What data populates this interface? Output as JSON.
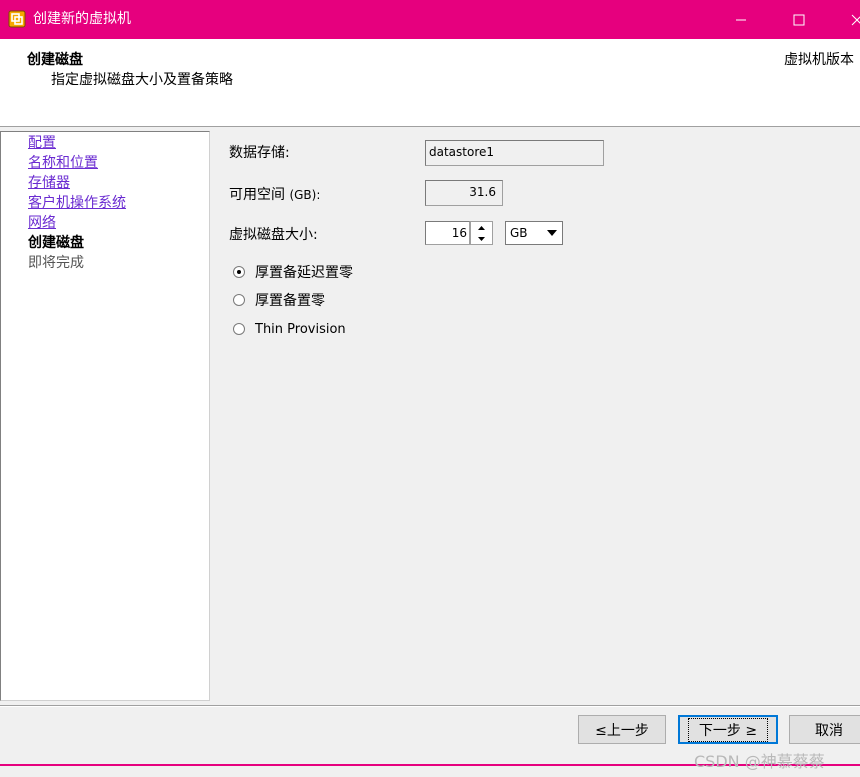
{
  "window": {
    "title": "创建新的虚拟机",
    "accent_color": "#e6007e",
    "controls": [
      "minimize-icon",
      "maximize-icon",
      "close-icon"
    ]
  },
  "header": {
    "title": "创建磁盘",
    "subtitle": "指定虚拟磁盘大小及置备策略",
    "version_label": "虚拟机版本"
  },
  "nav": {
    "items": [
      {
        "label": "配置",
        "state": "link"
      },
      {
        "label": "名称和位置",
        "state": "link"
      },
      {
        "label": "存储器",
        "state": "link"
      },
      {
        "label": "客户机操作系统",
        "state": "link"
      },
      {
        "label": "网络",
        "state": "link"
      },
      {
        "label": "创建磁盘",
        "state": "current"
      },
      {
        "label": "即将完成",
        "state": "disabled"
      }
    ]
  },
  "form": {
    "datastore_label": "数据存储:",
    "datastore_value": "datastore1",
    "space_label_main": "可用空间 ",
    "space_label_unit": "(GB):",
    "space_value": "31.6",
    "disk_size_label": "虚拟磁盘大小:",
    "disk_size_value": "16",
    "disk_size_unit": "GB",
    "provisioning_options": [
      {
        "label": "厚置备延迟置零",
        "checked": true
      },
      {
        "label": "厚置备置零",
        "checked": false
      },
      {
        "label": "Thin Provision",
        "checked": false
      }
    ]
  },
  "buttons": {
    "back": "≤上一步",
    "next": "下一步 ≥",
    "cancel": "取消"
  },
  "watermark": "CSDN @神慕蔡蔡"
}
